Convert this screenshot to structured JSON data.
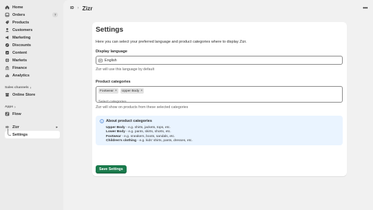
{
  "sidebar": {
    "items": [
      {
        "label": "Home",
        "icon": "home-icon"
      },
      {
        "label": "Orders",
        "icon": "orders-icon",
        "badge": "7"
      },
      {
        "label": "Products",
        "icon": "products-icon"
      },
      {
        "label": "Customers",
        "icon": "customers-icon"
      },
      {
        "label": "Marketing",
        "icon": "marketing-icon"
      },
      {
        "label": "Discounts",
        "icon": "discounts-icon"
      },
      {
        "label": "Content",
        "icon": "content-icon"
      },
      {
        "label": "Markets",
        "icon": "markets-icon"
      },
      {
        "label": "Finance",
        "icon": "finance-icon"
      },
      {
        "label": "Analytics",
        "icon": "analytics-icon"
      }
    ],
    "sales_channels_label": "Sales channels",
    "online_store_label": "Online Store",
    "apps_label": "Apps",
    "flow_label": "Flow",
    "app_label": "Zizr",
    "settings_label": "Settings"
  },
  "topbar": {
    "app_badge": "ID",
    "separator": "›",
    "app_name": "Zizr",
    "more": "•••"
  },
  "settings": {
    "title": "Settings",
    "intro": "Here you can select your preferred language and product categories where to display Zizr.",
    "language_label": "Display language",
    "language_value": "English",
    "language_help": "Zizr will use this language by default",
    "categories_label": "Product categories",
    "tags": [
      "Footwear",
      "Upper Body"
    ],
    "categories_placeholder": "Select categories",
    "categories_help": "Zizr will show on products from these selected categories",
    "info_title": "About product categories",
    "info_lines": [
      {
        "term": "Upper Body",
        "desc": " - e.g. shirts, jackets, tops, etc."
      },
      {
        "term": "Lower Body",
        "desc": " - e.g. pants, skirts, shorts, etc."
      },
      {
        "term": "Footwear",
        "desc": " - e.g. sneakers, boots, sandals, etc."
      },
      {
        "term": "Children's clothing",
        "desc": " - e.g. kids' shirts, pants, dresses, etc."
      }
    ],
    "save_label": "Save Settings"
  },
  "colors": {
    "primary_button": "#1a7a4c",
    "info_background": "#eaf4ff",
    "info_icon": "#2c6ecb"
  }
}
